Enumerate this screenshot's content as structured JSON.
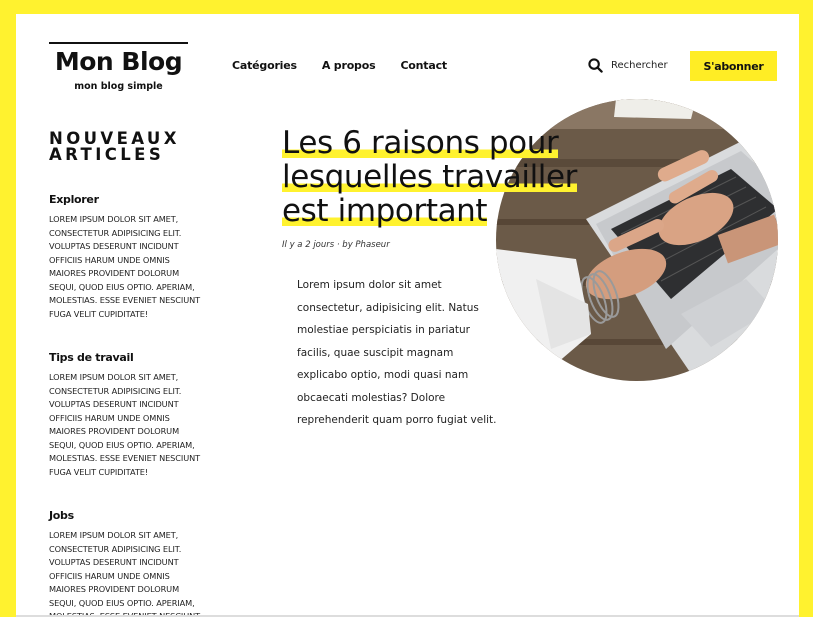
{
  "header": {
    "logo_title": "Mon Blog",
    "logo_subtitle": "mon blog simple",
    "nav": [
      "Catégories",
      "A propos",
      "Contact"
    ],
    "search_label": "Rechercher",
    "subscribe_label": "S'abonner"
  },
  "sidebar": {
    "title": "NOUVEAUX ARTICLES",
    "items": [
      {
        "title": "Explorer",
        "text": "Lorem ipsum dolor sit amet, consectetur adipisicing elit. Voluptas deserunt incidunt officiis harum unde omnis maiores provident dolorum sequi, quod eius optio. Aperiam, molestias. Esse eveniet nesciunt fuga velit cupiditate!"
      },
      {
        "title": "Tips de travail",
        "text": "Lorem ipsum dolor sit amet, consectetur adipisicing elit. Voluptas deserunt incidunt officiis harum unde omnis maiores provident dolorum sequi, quod eius optio. Aperiam, molestias. Esse eveniet nesciunt fuga velit cupiditate!"
      },
      {
        "title": "Jobs",
        "text": "Lorem ipsum dolor sit amet, consectetur adipisicing elit. Voluptas deserunt incidunt officiis harum unde omnis maiores provident dolorum sequi, quod eius optio. Aperiam, molestias. Esse eveniet nesciunt fuga velit cupiditate!"
      }
    ]
  },
  "article": {
    "headline_lines": [
      "Les 6 raisons pour",
      "lesquelles travailler",
      "est important"
    ],
    "meta": "Il y a 2 jours · by Phaseur",
    "body": "Lorem ipsum dolor sit amet consectetur, adipisicing elit. Natus molestiae perspiciatis in pariatur facilis, quae suscipit magnam explicabo optio, modi quasi nam obcaecati molestias? Dolore reprehenderit quam porro fugiat velit."
  },
  "colors": {
    "accent": "#fff22f",
    "button": "#ffed25"
  },
  "icons": {
    "search": "search-icon"
  }
}
